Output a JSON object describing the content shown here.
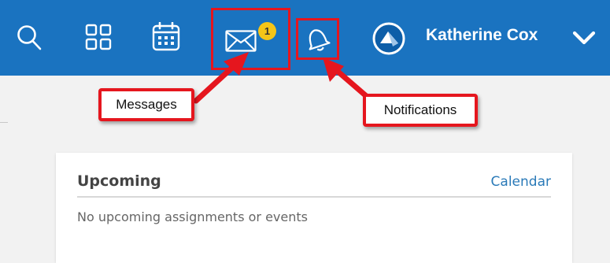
{
  "topbar": {
    "icons": {
      "search": "search-icon",
      "apps": "grid-icon",
      "calendar": "calendar-icon",
      "messages": "envelope-icon",
      "notifications": "bell-icon",
      "avatar": "avatar-icon",
      "menu": "chevron-down-icon"
    },
    "messages_badge": "1",
    "user_name": "Katherine Cox"
  },
  "callouts": {
    "messages": "Messages",
    "notifications": "Notifications"
  },
  "upcoming_card": {
    "title": "Upcoming",
    "link": "Calendar",
    "empty_text": "No upcoming assignments or events"
  },
  "colors": {
    "topbar": "#1a73c0",
    "badge": "#f5c518",
    "highlight": "#e5161e",
    "link": "#2a7ab8"
  }
}
